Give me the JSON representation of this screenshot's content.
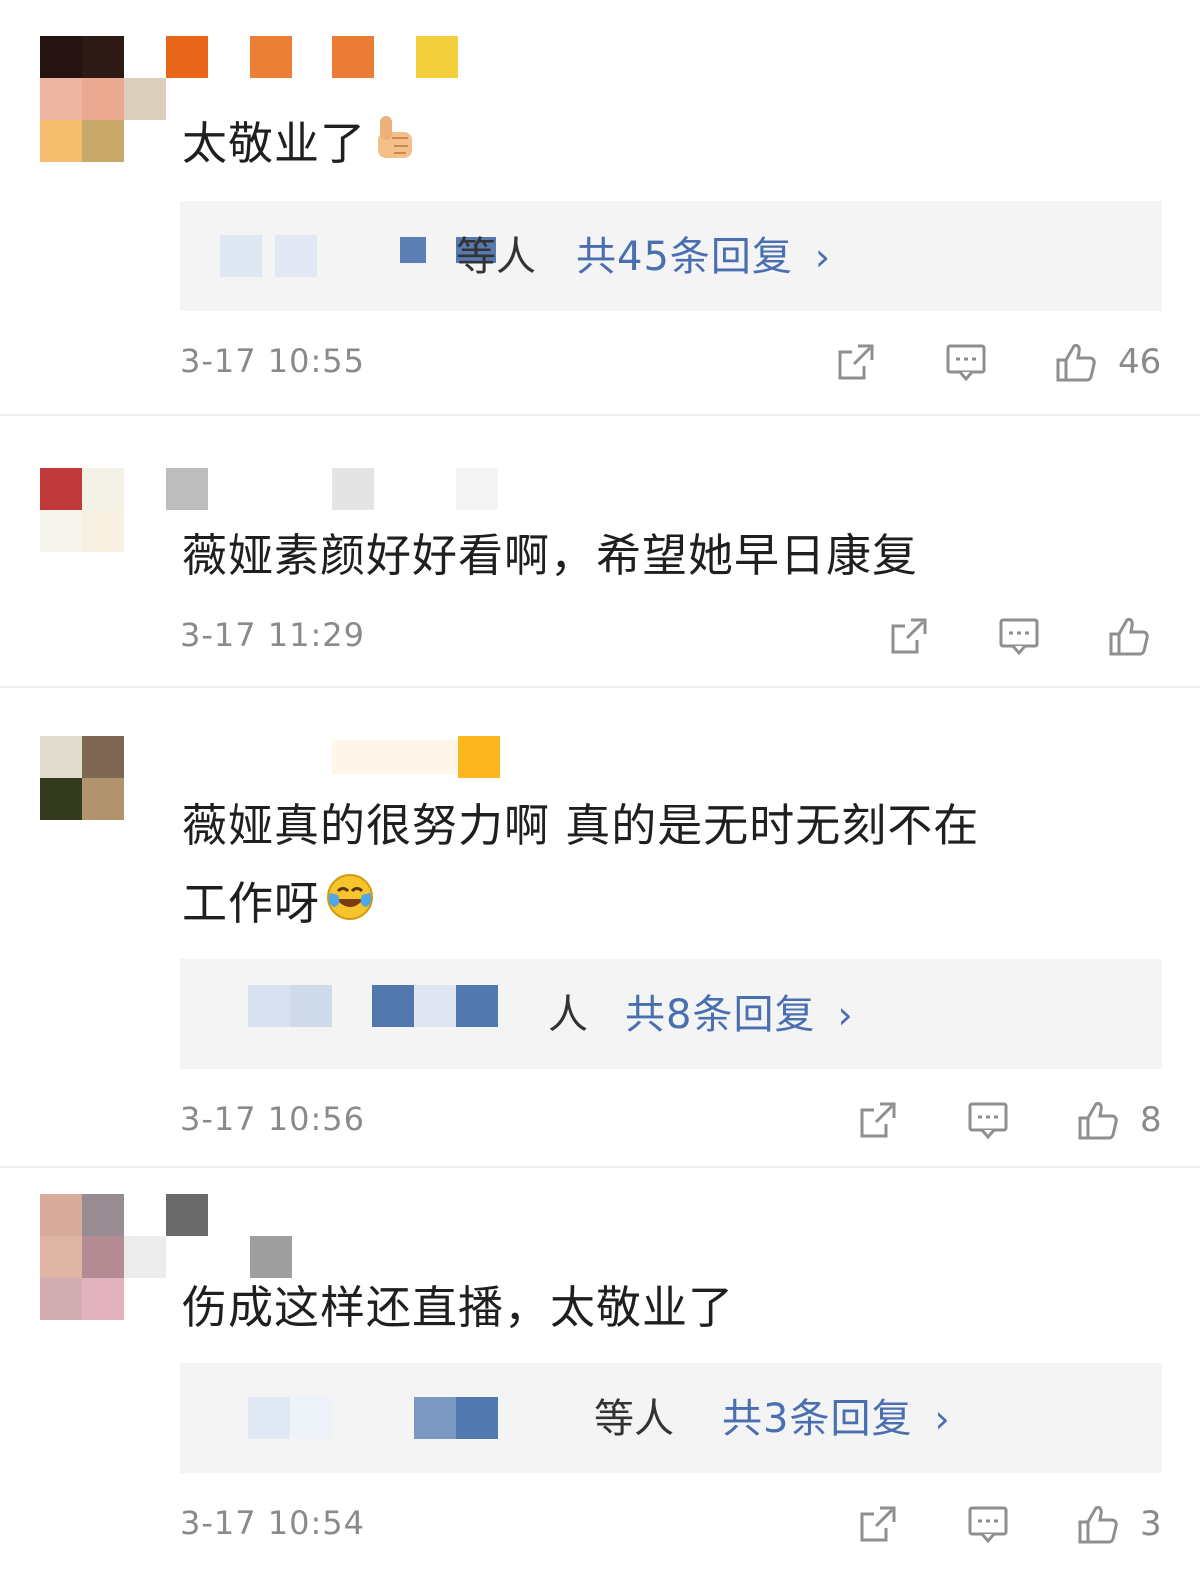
{
  "comments": [
    {
      "text": "太敬业了",
      "emoji": "thumbs-up",
      "reply_who": "等人",
      "reply_count": "共45条回复",
      "reply_chevron": "›",
      "time": "3-17 10:55",
      "likes": "46"
    },
    {
      "text": "薇娅素颜好好看啊，希望她早日康复",
      "time": "3-17 11:29",
      "likes": ""
    },
    {
      "text_line1": "薇娅真的很努力啊 真的是无时无刻不在",
      "text_line2": "工作呀",
      "emoji": "laughing-crying",
      "reply_who": "人",
      "reply_count": "共8条回复",
      "reply_chevron": "›",
      "time": "3-17 10:56",
      "likes": "8"
    },
    {
      "text": "伤成这样还直播，太敬业了",
      "reply_who": "等人",
      "reply_count": "共3条回复",
      "reply_chevron": "›",
      "time": "3-17 10:54",
      "likes": "3"
    }
  ],
  "icons": {
    "share": "share-icon",
    "comment": "comment-icon",
    "like": "like-icon"
  },
  "colors": {
    "link": "#4a6fb0",
    "meta": "#8a8a8a",
    "reply_bg": "#f4f4f4"
  }
}
